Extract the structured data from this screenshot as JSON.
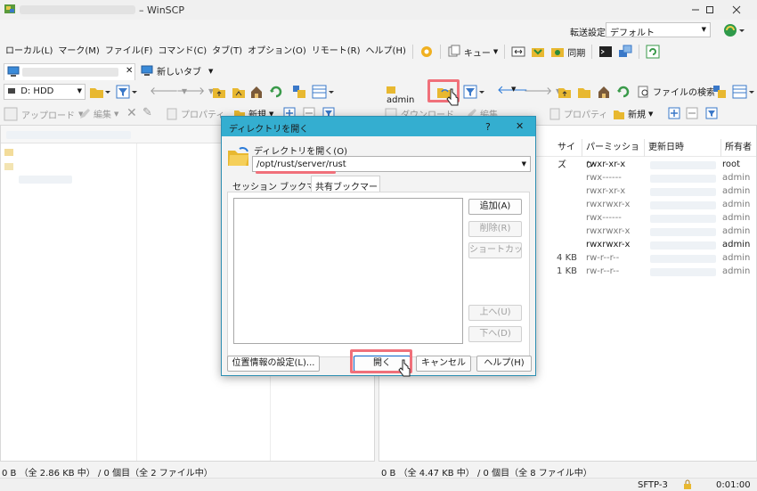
{
  "window": {
    "title": "– WinSCP"
  },
  "transfer": {
    "label": "転送設定",
    "value": "デフォルト"
  },
  "menu": [
    "ローカル(L)",
    "マーク(M)",
    "ファイル(F)",
    "コマンド(C)",
    "タブ(T)",
    "オプション(O)",
    "リモート(R)",
    "ヘルプ(H)"
  ],
  "toolbar": {
    "queue": "キュー",
    "sync": "同期"
  },
  "tabs": {
    "new_tab": "新しいタブ"
  },
  "local": {
    "drive": "D: HDD",
    "upload": "アップロード",
    "edit": "編集",
    "properties": "プロパティ",
    "new": "新規",
    "status": "0 B （全 2.86 KB 中） / 0 個目（全 2 ファイル中）"
  },
  "remote": {
    "path": "admin",
    "download": "ダウンロード",
    "edit": "編集",
    "properties": "プロパティ",
    "new": "新規",
    "find_files": "ファイルの検索",
    "columns": {
      "size": "サイズ",
      "permissions": "パーミッション",
      "modified": "更新日時",
      "owner": "所有者"
    },
    "rows": [
      {
        "size": "",
        "perm": "rwxr-xr-x",
        "owner": "root",
        "dim": false
      },
      {
        "size": "",
        "perm": "rwx------",
        "owner": "admin",
        "dim": true
      },
      {
        "size": "",
        "perm": "rwxr-xr-x",
        "owner": "admin",
        "dim": true
      },
      {
        "size": "",
        "perm": "rwxrwxr-x",
        "owner": "admin",
        "dim": true
      },
      {
        "size": "",
        "perm": "rwx------",
        "owner": "admin",
        "dim": true
      },
      {
        "size": "",
        "perm": "rwxrwxr-x",
        "owner": "admin",
        "dim": true
      },
      {
        "size": "",
        "perm": "rwxrwxr-x",
        "owner": "admin",
        "dim": false
      },
      {
        "size": "4 KB",
        "perm": "rw-r--r--",
        "owner": "admin",
        "dim": true
      },
      {
        "size": "1 KB",
        "perm": "rw-r--r--",
        "owner": "admin",
        "dim": true
      }
    ],
    "status": "0 B （全 4.47 KB 中） / 0 個目（全 8 ファイル中）"
  },
  "statusbar": {
    "protocol": "SFTP-3",
    "elapsed": "0:01:00"
  },
  "dialog": {
    "title": "ディレクトリを開く",
    "help_mark": "?",
    "close": "✕",
    "label": "ディレクトリを開く(O)",
    "path_value": "/opt/rust/server/rust",
    "tab_session": "セッション ブックマーク",
    "tab_shared": "共有ブックマーク",
    "add": "追加(A)",
    "delete": "削除(R)",
    "shortcut": "ショートカット(S)...",
    "up": "上へ(U)",
    "down": "下へ(D)",
    "location_settings": "位置情報の設定(L)...",
    "open": "開く",
    "cancel": "キャンセル",
    "help": "ヘルプ(H)"
  }
}
